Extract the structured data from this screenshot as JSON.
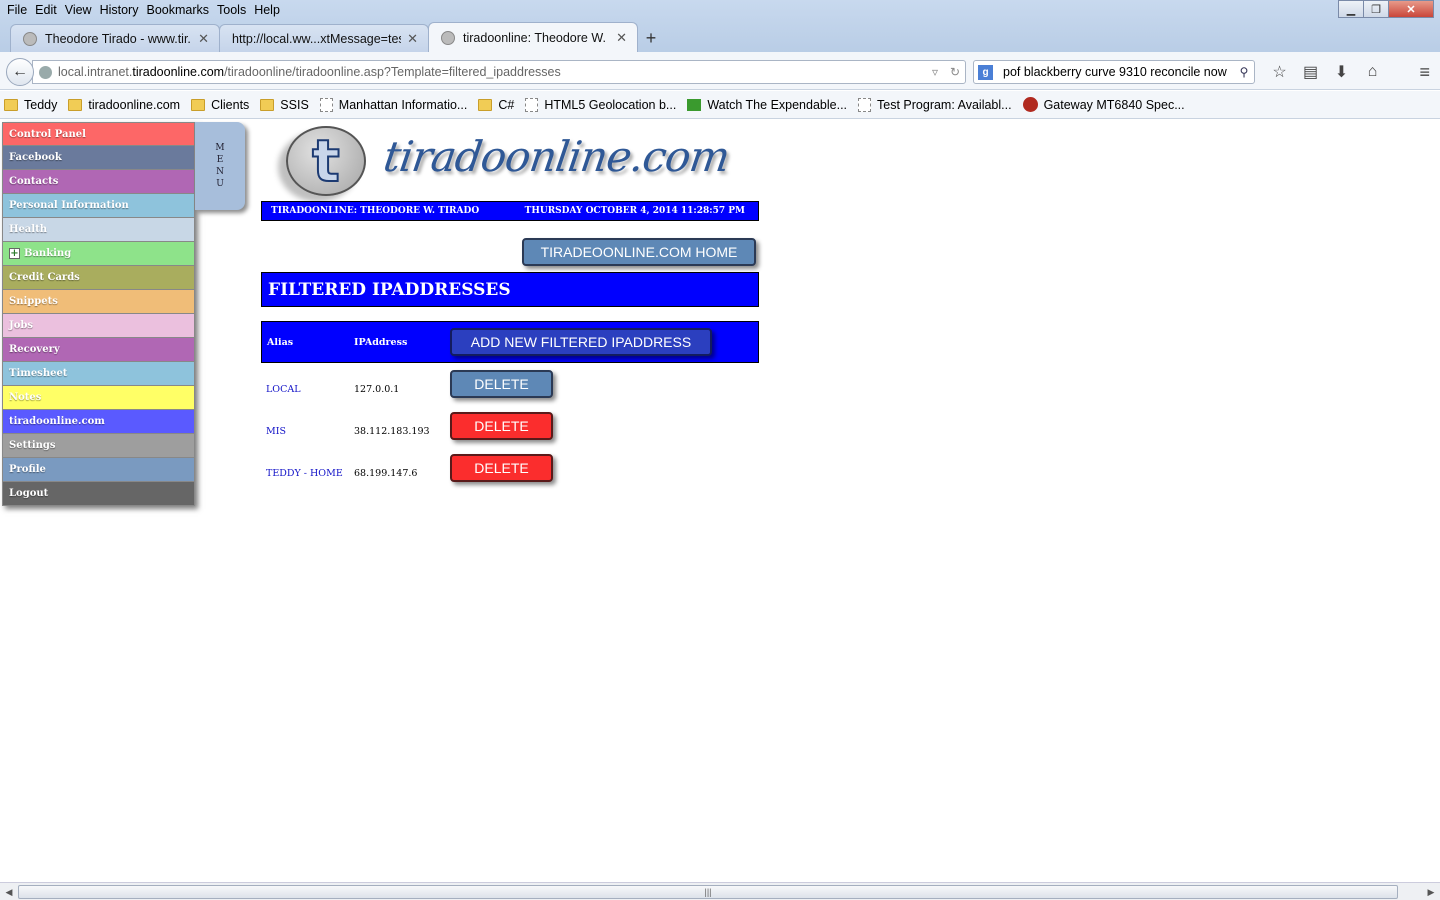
{
  "browser": {
    "menu": [
      "File",
      "Edit",
      "View",
      "History",
      "Bookmarks",
      "Tools",
      "Help"
    ],
    "tabs": [
      {
        "title": "Theodore Tirado - www.tir..."
      },
      {
        "title": "http://local.ww...xtMessage=test"
      },
      {
        "title": "tiradoonline: Theodore W. ..."
      }
    ],
    "url_prefix": "local.intranet.",
    "url_domain": "tiradoonline.com",
    "url_path": "/tiradoonline/tiradoonline.asp?Template=filtered_ipaddresses",
    "search_value": "pof blackberry curve 9310 reconcile now",
    "bookmarks": [
      {
        "label": "Teddy",
        "icon": "folder"
      },
      {
        "label": "tiradoonline.com",
        "icon": "folder"
      },
      {
        "label": "Clients",
        "icon": "folder"
      },
      {
        "label": "SSIS",
        "icon": "folder"
      },
      {
        "label": "Manhattan Informatio...",
        "icon": "page"
      },
      {
        "label": "C#",
        "icon": "folder"
      },
      {
        "label": "HTML5 Geolocation b...",
        "icon": "page"
      },
      {
        "label": "Watch The Expendable...",
        "icon": "video"
      },
      {
        "label": "Test Program: Availabl...",
        "icon": "page"
      },
      {
        "label": "Gateway MT6840 Spec...",
        "icon": "red"
      }
    ]
  },
  "sidemenu": {
    "items": [
      {
        "label": "Control Panel",
        "color": "#fd6767"
      },
      {
        "label": "Facebook",
        "color": "#6a7a9c"
      },
      {
        "label": "Contacts",
        "color": "#b067b4"
      },
      {
        "label": "Personal Information",
        "color": "#8ec3dc"
      },
      {
        "label": "Health",
        "color": "#c8d7e6"
      },
      {
        "label": "Banking",
        "color": "#8ee38a"
      },
      {
        "label": "Credit Cards",
        "color": "#a9ad5e"
      },
      {
        "label": "Snippets",
        "color": "#f0bd78"
      },
      {
        "label": "Jobs",
        "color": "#ebc0de"
      },
      {
        "label": "Recovery",
        "color": "#b067b4"
      },
      {
        "label": "Timesheet",
        "color": "#8ec3dc"
      },
      {
        "label": "Notes",
        "color": "#ffff66"
      },
      {
        "label": "tiradoonline.com",
        "color": "#5a5aff"
      },
      {
        "label": "Settings",
        "color": "#9e9e9e"
      },
      {
        "label": "Profile",
        "color": "#7a9ac0"
      },
      {
        "label": "Logout",
        "color": "#666666"
      }
    ],
    "tab_letters": [
      "M",
      "E",
      "N",
      "U"
    ]
  },
  "site": {
    "logo_letter": "t",
    "logo_text": "tiradoonline.com",
    "user_label": "TIRADOONLINE:  THEODORE W. TIRADO",
    "datetime": "THURSDAY OCTOBER 4, 2014 11:28:57 PM",
    "home_button": "TIRADEOONLINE.COM HOME"
  },
  "page": {
    "title": "FILTERED IPADDRESSES",
    "col_alias": "Alias",
    "col_ip": "IPAddress",
    "add_button": "ADD NEW FILTERED IPADDRESS",
    "delete_label": "DELETE",
    "rows": [
      {
        "alias": "LOCAL",
        "ip": "127.0.0.1",
        "delete_color": "blue"
      },
      {
        "alias": "MIS",
        "ip": "38.112.183.193",
        "delete_color": "red"
      },
      {
        "alias": "TEDDY - HOME",
        "ip": "68.199.147.6",
        "delete_color": "red"
      }
    ]
  }
}
